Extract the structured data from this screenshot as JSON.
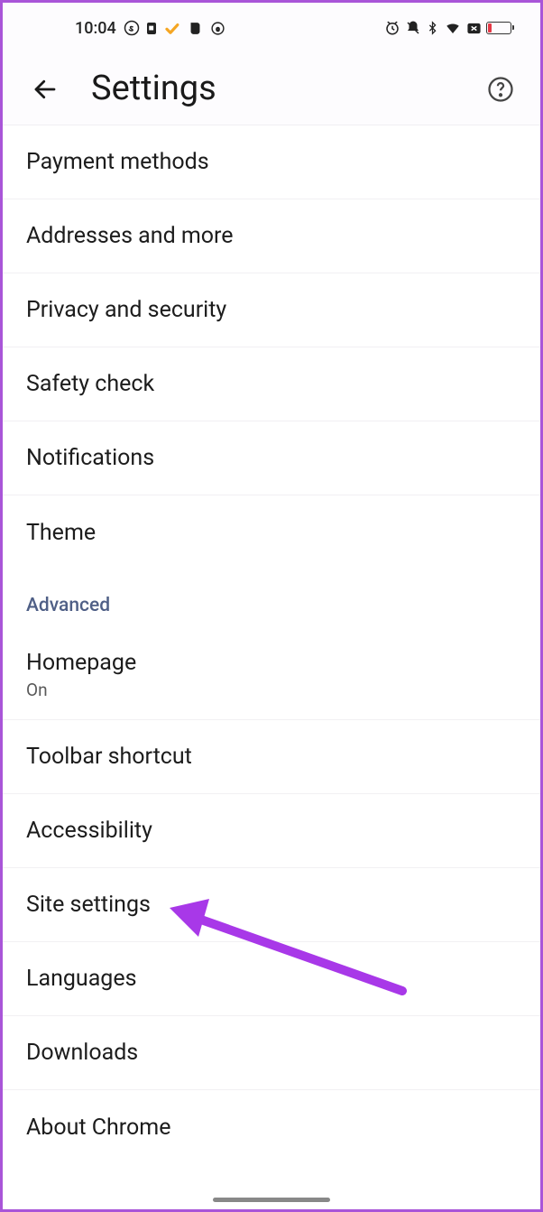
{
  "status_bar": {
    "time": "10:04"
  },
  "header": {
    "title": "Settings"
  },
  "items": [
    {
      "label": "Payment methods"
    },
    {
      "label": "Addresses and more"
    },
    {
      "label": "Privacy and security"
    },
    {
      "label": "Safety check"
    },
    {
      "label": "Notifications"
    },
    {
      "label": "Theme"
    }
  ],
  "section": {
    "label": "Advanced"
  },
  "advanced_items": [
    {
      "label": "Homepage",
      "subtitle": "On"
    },
    {
      "label": "Toolbar shortcut"
    },
    {
      "label": "Accessibility"
    },
    {
      "label": "Site settings"
    },
    {
      "label": "Languages"
    },
    {
      "label": "Downloads"
    },
    {
      "label": "About Chrome"
    }
  ]
}
